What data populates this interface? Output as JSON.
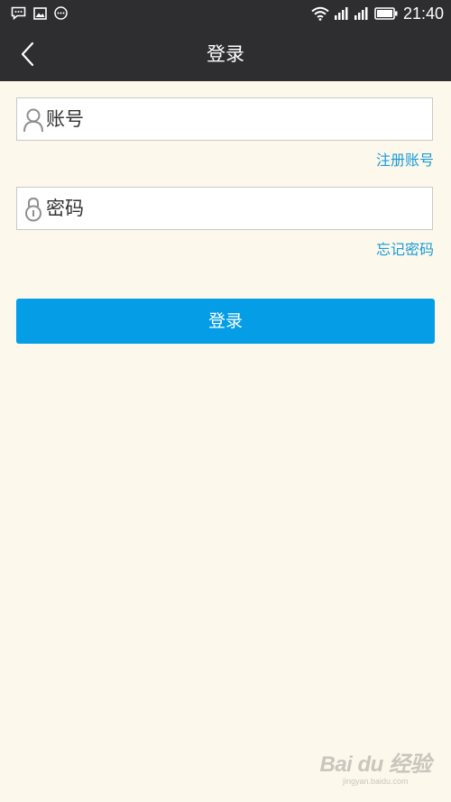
{
  "status_bar": {
    "time": "21:40"
  },
  "header": {
    "title": "登录",
    "back_icon": "chevron-left-icon"
  },
  "form": {
    "account_placeholder": "账号",
    "account_icon": "user-icon",
    "register_link": "注册账号",
    "password_placeholder": "密码",
    "password_icon": "lock-icon",
    "forgot_link": "忘记密码",
    "login_button": "登录"
  },
  "watermark": {
    "main": "Bai du 经验",
    "sub": "jingyan.baidu.com"
  },
  "colors": {
    "background": "#fdf8ec",
    "header": "#2e2e30",
    "accent": "#049de6",
    "link": "#1a9bd8"
  }
}
